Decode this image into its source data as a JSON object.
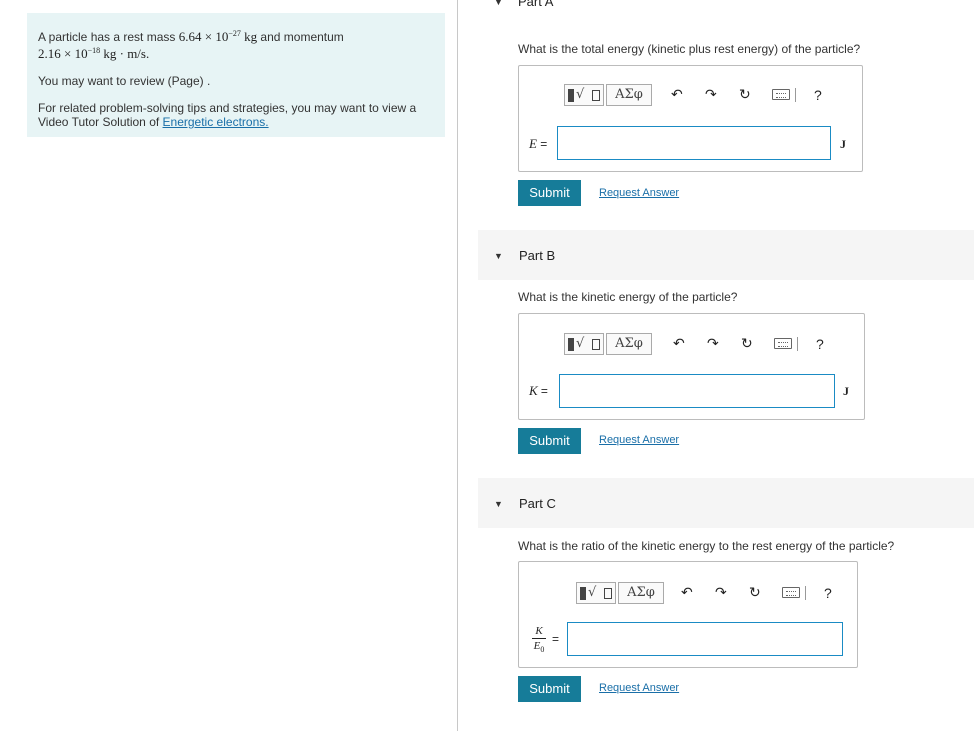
{
  "problem": {
    "intro_before_mass": "A particle has a rest mass ",
    "mass_mantissa": "6.64 × 10",
    "mass_exponent": "−27",
    "mass_unit": " kg",
    "intro_after_mass": " and momentum",
    "momentum_mantissa": "2.16 × 10",
    "momentum_exponent": "−18",
    "momentum_unit": " kg · m/s",
    "momentum_period": ".",
    "review": "You may want to review (Page) .",
    "tips_line1": "For related problem-solving tips and strategies, you may want to view a",
    "tips_line2_prefix": "Video Tutor Solution of ",
    "tips_link": "Energetic electrons."
  },
  "toolbar": {
    "radical_glyph": "√",
    "greek_label": "ΑΣφ",
    "undo_icon": "↶",
    "redo_icon": "↷",
    "reset_icon": "↻",
    "help_label": "?"
  },
  "part_a": {
    "title": "Part A",
    "question": "What is the total energy (kinetic plus rest energy) of the particle?",
    "var": "E",
    "eq": "=",
    "unit": "J",
    "value": "",
    "submit": "Submit",
    "request": "Request Answer"
  },
  "part_b": {
    "title": "Part B",
    "question": "What is the kinetic energy of the particle?",
    "var": "K",
    "eq": "=",
    "unit": "J",
    "value": "",
    "submit": "Submit",
    "request": "Request Answer"
  },
  "part_c": {
    "title": "Part C",
    "question": "What is the ratio of the kinetic energy to the rest energy of the particle?",
    "frac_num": "K",
    "frac_den": "E",
    "frac_den_sub": "0",
    "eq": "=",
    "value": "",
    "submit": "Submit",
    "request": "Request Answer"
  },
  "colors": {
    "panel_bg": "#e7f4f5",
    "submit_bg": "#167c99",
    "link": "#1a6fa8",
    "input_border": "#1a8bc4"
  }
}
